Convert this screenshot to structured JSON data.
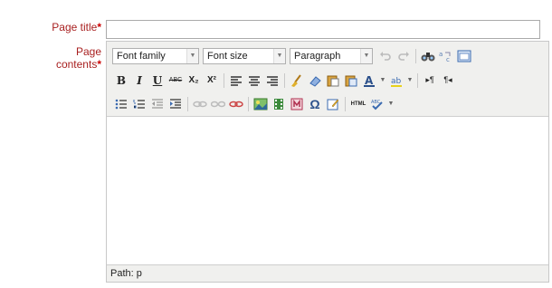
{
  "form": {
    "title_label": "Page title",
    "contents_label_1": "Page",
    "contents_label_2": "contents",
    "required_mark": "*",
    "title_value": ""
  },
  "toolbar": {
    "font_family": "Font family",
    "font_size": "Font size",
    "format": "Paragraph",
    "bold": "B",
    "italic": "I",
    "underline": "U",
    "strikethrough": "ABC",
    "subscript": "X₂",
    "superscript": "X²",
    "html": "HTML"
  },
  "editor": {
    "content": ""
  },
  "status": {
    "path": "Path: p"
  },
  "colors": {
    "label": "#a81f1f",
    "toolbar_bg": "#f0f0ee",
    "border": "#c8c8c8"
  }
}
